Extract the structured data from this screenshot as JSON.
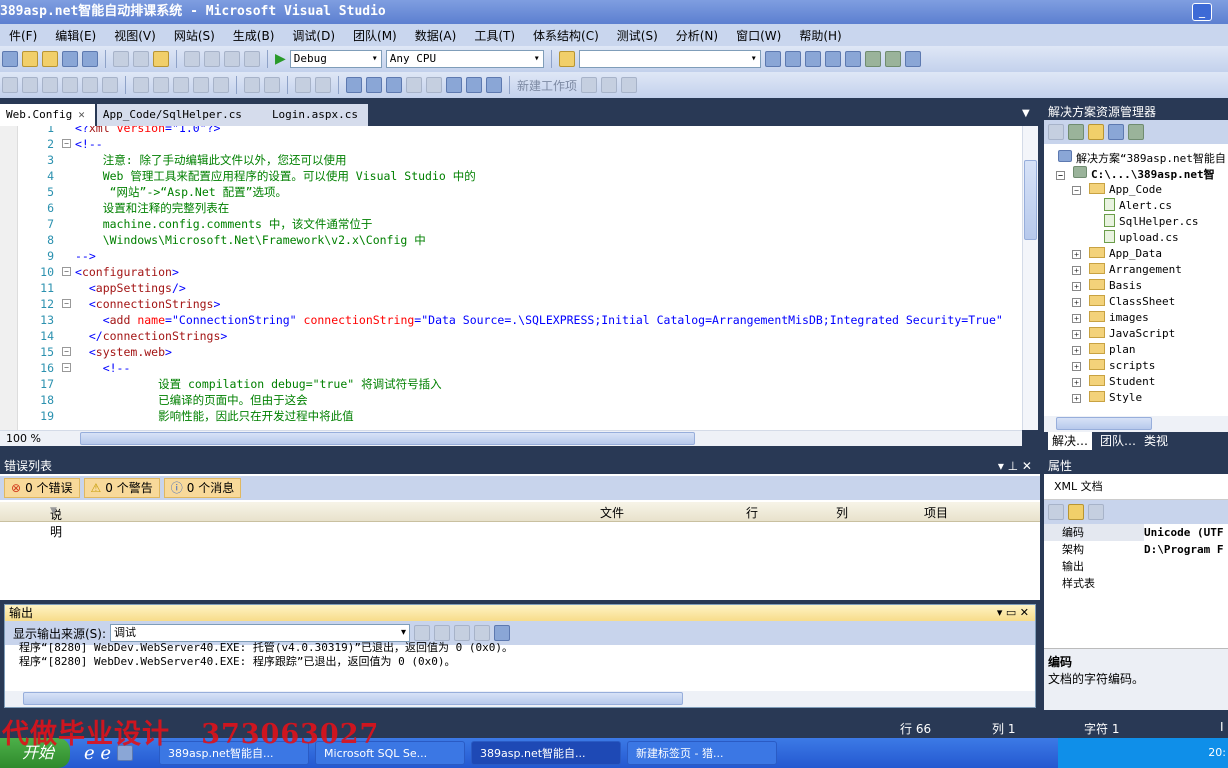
{
  "window": {
    "title": "389asp.net智能自动排课系统 - Microsoft Visual Studio",
    "minimize": "_"
  },
  "menu": [
    "件(F)",
    "编辑(E)",
    "视图(V)",
    "网站(S)",
    "生成(B)",
    "调试(D)",
    "团队(M)",
    "数据(A)",
    "工具(T)",
    "体系结构(C)",
    "测试(S)",
    "分析(N)",
    "窗口(W)",
    "帮助(H)"
  ],
  "toolbar": {
    "config": "Debug",
    "platform": "Any CPU",
    "find_value": "",
    "new_work_item": "新建工作项"
  },
  "tabs": [
    {
      "label": "Web.Config",
      "active": true,
      "close": "✕"
    },
    {
      "label": "App_Code/SqlHelper.cs"
    },
    {
      "label": "Login.aspx.cs"
    }
  ],
  "editor": {
    "zoom": "100 %",
    "lines": [
      {
        "n": "1",
        "fold": "",
        "segs": [
          {
            "c": "punct",
            "t": "<?"
          },
          {
            "c": "tag",
            "t": "xml"
          },
          {
            "c": "attr",
            "t": " version"
          },
          {
            "c": "punct",
            "t": "="
          },
          {
            "c": "value",
            "t": "\"1.0\""
          },
          {
            "c": "punct",
            "t": "?>"
          }
        ]
      },
      {
        "n": "2",
        "fold": "−",
        "segs": [
          {
            "c": "punct",
            "t": "<!--"
          }
        ]
      },
      {
        "n": "3",
        "fold": "",
        "segs": [
          {
            "c": "comment",
            "t": "    注意: 除了手动编辑此文件以外，您还可以使用"
          }
        ]
      },
      {
        "n": "4",
        "fold": "",
        "segs": [
          {
            "c": "comment",
            "t": "    Web 管理工具来配置应用程序的设置。可以使用 Visual Studio 中的"
          }
        ]
      },
      {
        "n": "5",
        "fold": "",
        "segs": [
          {
            "c": "comment",
            "t": "     “网站”->“Asp.Net 配置”选项。"
          }
        ]
      },
      {
        "n": "6",
        "fold": "",
        "segs": [
          {
            "c": "comment",
            "t": "    设置和注释的完整列表在"
          }
        ]
      },
      {
        "n": "7",
        "fold": "",
        "segs": [
          {
            "c": "comment",
            "t": "    machine.config.comments 中，该文件通常位于"
          }
        ]
      },
      {
        "n": "8",
        "fold": "",
        "segs": [
          {
            "c": "comment",
            "t": "    \\Windows\\Microsoft.Net\\Framework\\v2.x\\Config 中"
          }
        ]
      },
      {
        "n": "9",
        "fold": "",
        "segs": [
          {
            "c": "punct",
            "t": "-->"
          }
        ]
      },
      {
        "n": "10",
        "fold": "−",
        "segs": [
          {
            "c": "punct",
            "t": "<"
          },
          {
            "c": "tag",
            "t": "configuration"
          },
          {
            "c": "punct",
            "t": ">"
          }
        ]
      },
      {
        "n": "11",
        "fold": "",
        "segs": [
          {
            "c": "punct",
            "t": "  <"
          },
          {
            "c": "tag",
            "t": "appSettings"
          },
          {
            "c": "punct",
            "t": "/>"
          }
        ]
      },
      {
        "n": "12",
        "fold": "−",
        "segs": [
          {
            "c": "punct",
            "t": "  <"
          },
          {
            "c": "tag",
            "t": "connectionStrings"
          },
          {
            "c": "punct",
            "t": ">"
          }
        ]
      },
      {
        "n": "13",
        "fold": "",
        "segs": [
          {
            "c": "punct",
            "t": "    <"
          },
          {
            "c": "tag",
            "t": "add"
          },
          {
            "c": "attr",
            "t": " name"
          },
          {
            "c": "punct",
            "t": "="
          },
          {
            "c": "value",
            "t": "\"ConnectionString\""
          },
          {
            "c": "attr",
            "t": " connectionString"
          },
          {
            "c": "punct",
            "t": "="
          },
          {
            "c": "value",
            "t": "\"Data Source=.\\SQLEXPRESS;Initial Catalog=ArrangementMisDB;Integrated Security=True\""
          },
          {
            "c": "punct",
            "t": " "
          }
        ]
      },
      {
        "n": "14",
        "fold": "",
        "segs": [
          {
            "c": "punct",
            "t": "  </"
          },
          {
            "c": "tag",
            "t": "connectionStrings"
          },
          {
            "c": "punct",
            "t": ">"
          }
        ]
      },
      {
        "n": "15",
        "fold": "−",
        "segs": [
          {
            "c": "punct",
            "t": "  <"
          },
          {
            "c": "tag",
            "t": "system.web"
          },
          {
            "c": "punct",
            "t": ">"
          }
        ]
      },
      {
        "n": "16",
        "fold": "−",
        "segs": [
          {
            "c": "punct",
            "t": "    <!--"
          }
        ]
      },
      {
        "n": "17",
        "fold": "",
        "segs": [
          {
            "c": "comment",
            "t": "            设置 compilation debug=\"true\" 将调试符号插入"
          }
        ]
      },
      {
        "n": "18",
        "fold": "",
        "segs": [
          {
            "c": "comment",
            "t": "            已编译的页面中。但由于这会"
          }
        ]
      },
      {
        "n": "19",
        "fold": "",
        "segs": [
          {
            "c": "comment",
            "t": "            影响性能，因此只在开发过程中将此值"
          }
        ]
      }
    ]
  },
  "solution_explorer": {
    "title": "解决方案资源管理器",
    "solution": "解决方案“389asp.net智能自",
    "project": "C:\\...\\389asp.net智",
    "items": [
      {
        "label": "App_Code",
        "type": "folder",
        "level": 1,
        "expanded": true
      },
      {
        "label": "Alert.cs",
        "type": "cs",
        "level": 2
      },
      {
        "label": "SqlHelper.cs",
        "type": "cs",
        "level": 2
      },
      {
        "label": "upload.cs",
        "type": "cs",
        "level": 2
      },
      {
        "label": "App_Data",
        "type": "folder",
        "level": 1
      },
      {
        "label": "Arrangement",
        "type": "folder",
        "level": 1
      },
      {
        "label": "Basis",
        "type": "folder",
        "level": 1
      },
      {
        "label": "ClassSheet",
        "type": "folder",
        "level": 1
      },
      {
        "label": "images",
        "type": "folder",
        "level": 1
      },
      {
        "label": "JavaScript",
        "type": "folder",
        "level": 1
      },
      {
        "label": "plan",
        "type": "folder",
        "level": 1
      },
      {
        "label": "scripts",
        "type": "folder",
        "level": 1
      },
      {
        "label": "Student",
        "type": "folder",
        "level": 1
      },
      {
        "label": "Style",
        "type": "folder",
        "level": 1
      }
    ],
    "bottom_tabs": [
      "解决…",
      "团队…",
      "类视"
    ]
  },
  "error_list": {
    "title": "错误列表",
    "errors": "0 个错误",
    "warnings": "0 个警告",
    "messages": "0 个消息",
    "columns": [
      "说明",
      "文件",
      "行",
      "列",
      "项目"
    ]
  },
  "output": {
    "title": "输出",
    "source_label": "显示输出来源(S):",
    "source_value": "调试",
    "lines": [
      "程序“[8280] WebDev.WebServer40.EXE: 托管(v4.0.30319)”已退出，返回值为 0 (0x0)。",
      "程序“[8280] WebDev.WebServer40.EXE: 程序跟踪”已退出，返回值为 0 (0x0)。"
    ]
  },
  "properties": {
    "title": "属性",
    "object": "XML 文档",
    "rows": [
      {
        "name": "编码",
        "value": "Unicode (UTF"
      },
      {
        "name": "架构",
        "value": "D:\\Program F"
      },
      {
        "name": "输出",
        "value": ""
      },
      {
        "name": "样式表",
        "value": ""
      }
    ],
    "desc_title": "编码",
    "desc_text": "文档的字符编码。"
  },
  "status": {
    "line": "行 66",
    "col": "列 1",
    "char": "字符 1",
    "mode": "I"
  },
  "watermark": "代做毕业设计   373063027",
  "taskbar": {
    "start": "开始",
    "tasks": [
      "389asp.net智能自...",
      "Microsoft SQL Se...",
      "389asp.net智能自...",
      "新建标签页 - 猎..."
    ],
    "clock": "20:"
  }
}
